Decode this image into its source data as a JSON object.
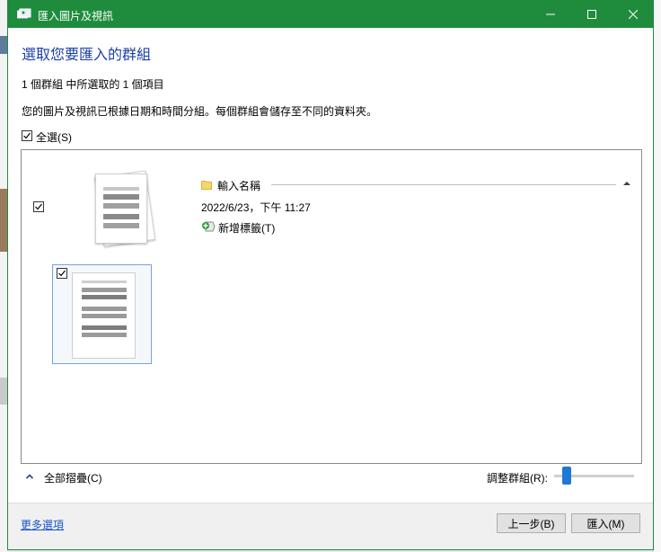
{
  "window": {
    "title": "匯入圖片及視訊"
  },
  "heading": "選取您要匯入的群組",
  "selection_summary": "1 個群組 中所選取的 1 個項目",
  "description": "您的圖片及視訊已根據日期和時間分組。每個群組會儲存至不同的資料夾。",
  "select_all": {
    "label": "全選(S)",
    "checked": true
  },
  "group": {
    "checked": true,
    "name_placeholder": "輸入名稱",
    "date": "2022/6/23，下午 11:27",
    "add_tag_label": "新增標籤(T)",
    "item_checked": true
  },
  "collapse_all_label": "全部摺疊(C)",
  "adjust_groups_label": "調整群組(R):",
  "adjust_groups_level": 0.1,
  "footer": {
    "more_options": "更多選項",
    "back_button": "上一步(B)",
    "import_button": "匯入(M)"
  },
  "colors": {
    "titlebar": "#1e8c3c",
    "heading": "#1a3fa8",
    "link": "#1a56c9",
    "slider": "#1e78d6"
  }
}
